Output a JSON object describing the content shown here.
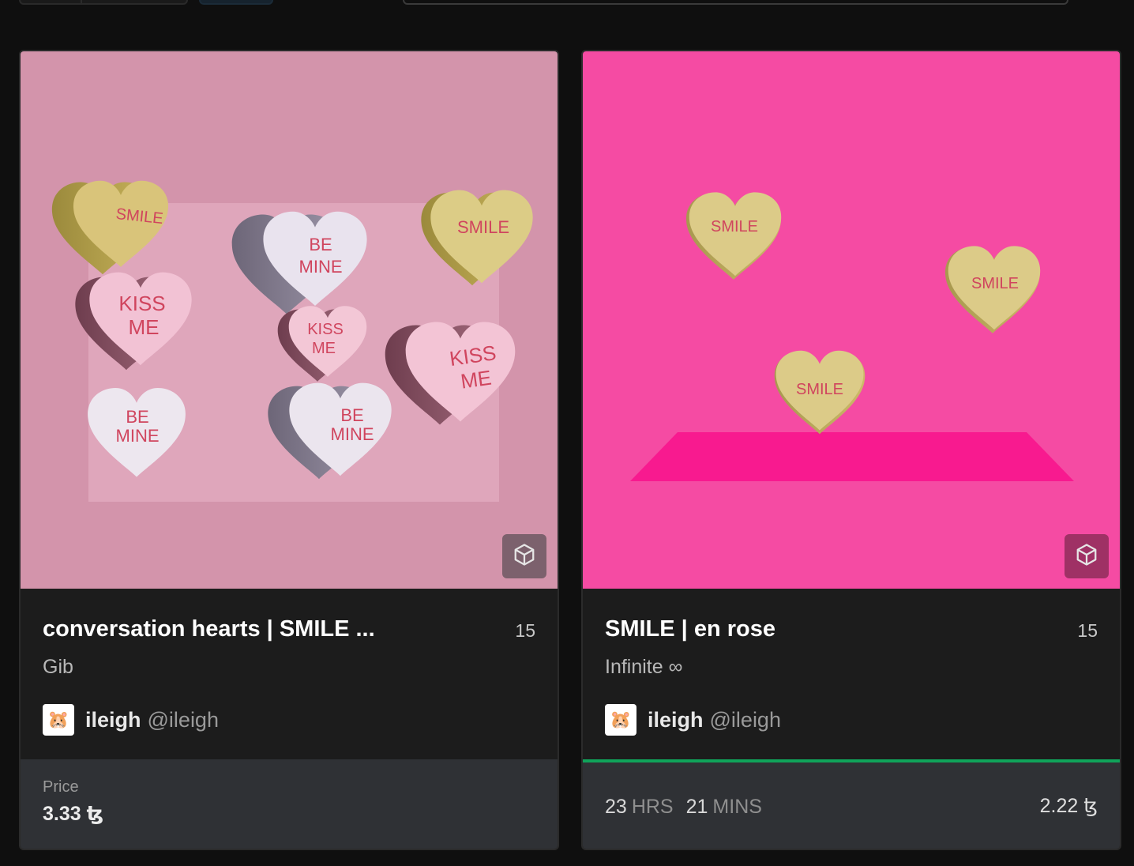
{
  "cards": [
    {
      "title": "conversation hearts | SMILE ...",
      "editions": "15",
      "collection": "Gib",
      "artist": {
        "name": "ileigh",
        "handle": "@ileigh",
        "avatar": "🐹"
      },
      "media": {
        "type": "3d-model",
        "background": "#d394ab",
        "hearts": [
          "SMILE",
          "KISS ME",
          "BE MINE",
          "BE MINE",
          "KISS ME",
          "BE MINE",
          "SMILE",
          "KISS ME",
          "BE MINE"
        ]
      },
      "model_icon": "cube-icon",
      "footer": {
        "price_label": "Price",
        "price": "3.33 ꜩ"
      }
    },
    {
      "title": "SMILE | en rose",
      "editions": "15",
      "collection": "Infinite ∞",
      "artist": {
        "name": "ileigh",
        "handle": "@ileigh",
        "avatar": "🐹"
      },
      "media": {
        "type": "3d-model",
        "background": "#f54ba3",
        "hearts": [
          "SMILE",
          "SMILE",
          "SMILE"
        ]
      },
      "model_icon": "cube-icon",
      "footer": {
        "auction_active_color": "#10a35a",
        "timer": {
          "hours": "23",
          "hours_unit": "HRS",
          "minutes": "21",
          "minutes_unit": "MINS"
        },
        "bid": "2.22 ꜩ"
      }
    }
  ]
}
